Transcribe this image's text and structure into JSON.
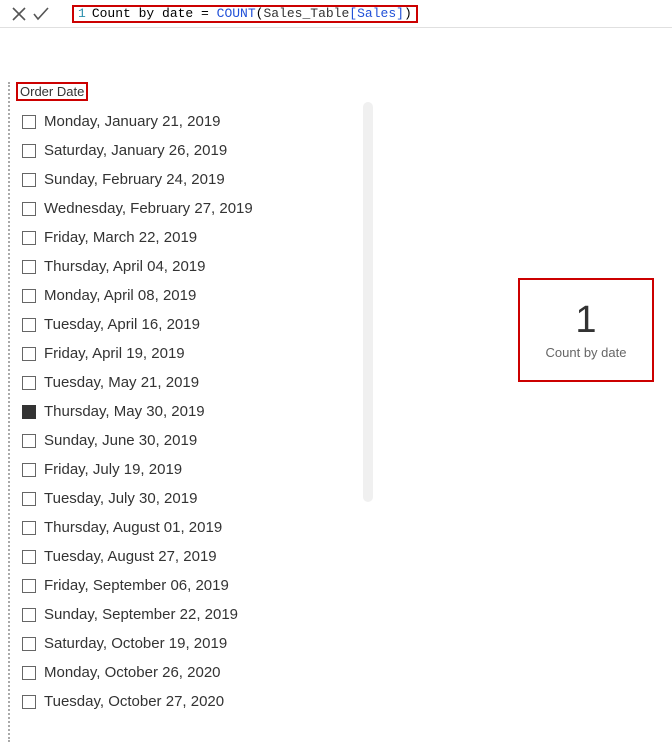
{
  "formula_bar": {
    "line_number": "1",
    "measure_name": "Count by date",
    "assign_op": " = ",
    "function_name": "COUNT",
    "open_paren": "(",
    "table_ref": "Sales_Table",
    "col_open": "[",
    "col_name": "Sales",
    "col_close": "]",
    "close_paren": ")"
  },
  "slicer": {
    "header": "Order Date",
    "items": [
      {
        "label": "Monday, January 21, 2019",
        "selected": false
      },
      {
        "label": "Saturday, January 26, 2019",
        "selected": false
      },
      {
        "label": "Sunday, February 24, 2019",
        "selected": false
      },
      {
        "label": "Wednesday, February 27, 2019",
        "selected": false
      },
      {
        "label": "Friday, March 22, 2019",
        "selected": false
      },
      {
        "label": "Thursday, April 04, 2019",
        "selected": false
      },
      {
        "label": "Monday, April 08, 2019",
        "selected": false
      },
      {
        "label": "Tuesday, April 16, 2019",
        "selected": false
      },
      {
        "label": "Friday, April 19, 2019",
        "selected": false
      },
      {
        "label": "Tuesday, May 21, 2019",
        "selected": false
      },
      {
        "label": "Thursday, May 30, 2019",
        "selected": true
      },
      {
        "label": "Sunday, June 30, 2019",
        "selected": false
      },
      {
        "label": "Friday, July 19, 2019",
        "selected": false
      },
      {
        "label": "Tuesday, July 30, 2019",
        "selected": false
      },
      {
        "label": "Thursday, August 01, 2019",
        "selected": false
      },
      {
        "label": "Tuesday, August 27, 2019",
        "selected": false
      },
      {
        "label": "Friday, September 06, 2019",
        "selected": false
      },
      {
        "label": "Sunday, September 22, 2019",
        "selected": false
      },
      {
        "label": "Saturday, October 19, 2019",
        "selected": false
      },
      {
        "label": "Monday, October 26, 2020",
        "selected": false
      },
      {
        "label": "Tuesday, October 27, 2020",
        "selected": false
      }
    ]
  },
  "card": {
    "value": "1",
    "label": "Count by date"
  }
}
